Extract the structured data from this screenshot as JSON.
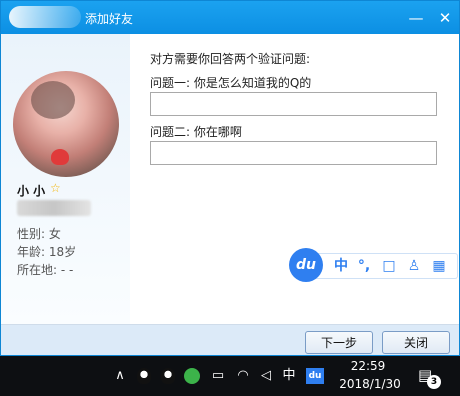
{
  "window": {
    "title": "添加好友",
    "minimize_label": "—",
    "close_label": "✕"
  },
  "profile": {
    "nickname": "小 小",
    "star_icon": "☆",
    "gender": "性别: 女",
    "age": "年龄: 18岁",
    "location": "所在地:  -    -"
  },
  "verification": {
    "prompt": "对方需要你回答两个验证问题:",
    "question1": "问题一: 你是怎么知道我的Q的",
    "answer1": "",
    "question2": "问题二: 你在哪啊",
    "answer2": ""
  },
  "buttons": {
    "next": "下一步",
    "close": "关闭"
  },
  "ime_toolbar": {
    "logo": "du",
    "mode": "中",
    "punct": "°,",
    "cup": "□",
    "user": "♙",
    "grid": "▦"
  },
  "taskbar": {
    "chevron": "∧",
    "input_indicator": "中",
    "ime_badge": "du",
    "time": "22:59",
    "date": "2018/1/30",
    "notification_count": "3"
  },
  "colors": {
    "titlebar": "#0c8fe3",
    "accent": "#2f7ff0",
    "footer": "#dceaf8"
  }
}
